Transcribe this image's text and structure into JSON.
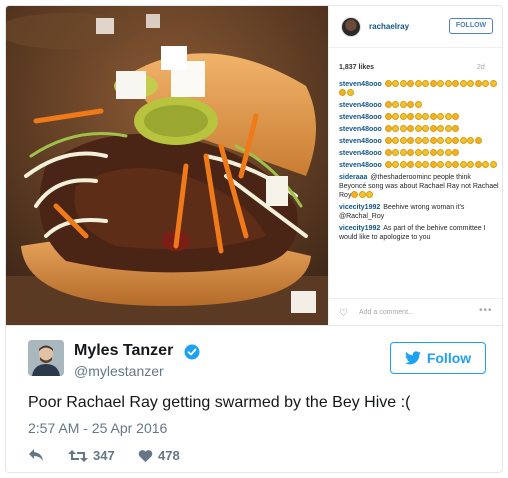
{
  "instagram": {
    "username": "rachaelray",
    "follow_label": "FOLLOW",
    "likes": "1,837 likes",
    "age": "2d",
    "add_comment_placeholder": "Add a comment...",
    "more_label": "•••",
    "comments": [
      {
        "user": "steven48ooo",
        "text": "",
        "emoji_count": 17
      },
      {
        "user": "steven48ooo",
        "text": "",
        "emoji_count": 5
      },
      {
        "user": "steven48ooo",
        "text": "",
        "emoji_count": 10
      },
      {
        "user": "steven48ooo",
        "text": "",
        "emoji_count": 10
      },
      {
        "user": "steven48ooo",
        "text": "",
        "emoji_count": 13
      },
      {
        "user": "steven48ooo",
        "text": "",
        "emoji_count": 10
      },
      {
        "user": "steven48ooo",
        "text": "",
        "emoji_count": 15
      },
      {
        "user": "sideraaa",
        "text": "@theshaderoominc people think Beyoncé song was about Rachael Ray not Rachael Roy",
        "emoji_count": 3
      },
      {
        "user": "vicecity1992",
        "text": "Beehive wrong woman it's @Rachal_Roy",
        "emoji_count": 0
      },
      {
        "user": "vicecity1992",
        "text": "As part of the behive committee I would like to apologize to you",
        "emoji_count": 0
      }
    ]
  },
  "tweet": {
    "author_name": "Myles Tanzer",
    "author_handle": "@mylestanzer",
    "follow_label": "Follow",
    "text": "Poor Rachael Ray getting swarmed by the Bey Hive :(",
    "timestamp": "2:57 AM - 25 Apr 2016",
    "retweets": "347",
    "likes": "478"
  },
  "colors": {
    "twitter_blue": "#1da1f2",
    "instagram_link": "#125688",
    "secondary_text": "#657786",
    "like_red": "#657786"
  },
  "icons": [
    "verified-icon",
    "twitter-bird-icon",
    "reply-icon",
    "retweet-icon",
    "heart-icon",
    "ig-heart-icon"
  ]
}
